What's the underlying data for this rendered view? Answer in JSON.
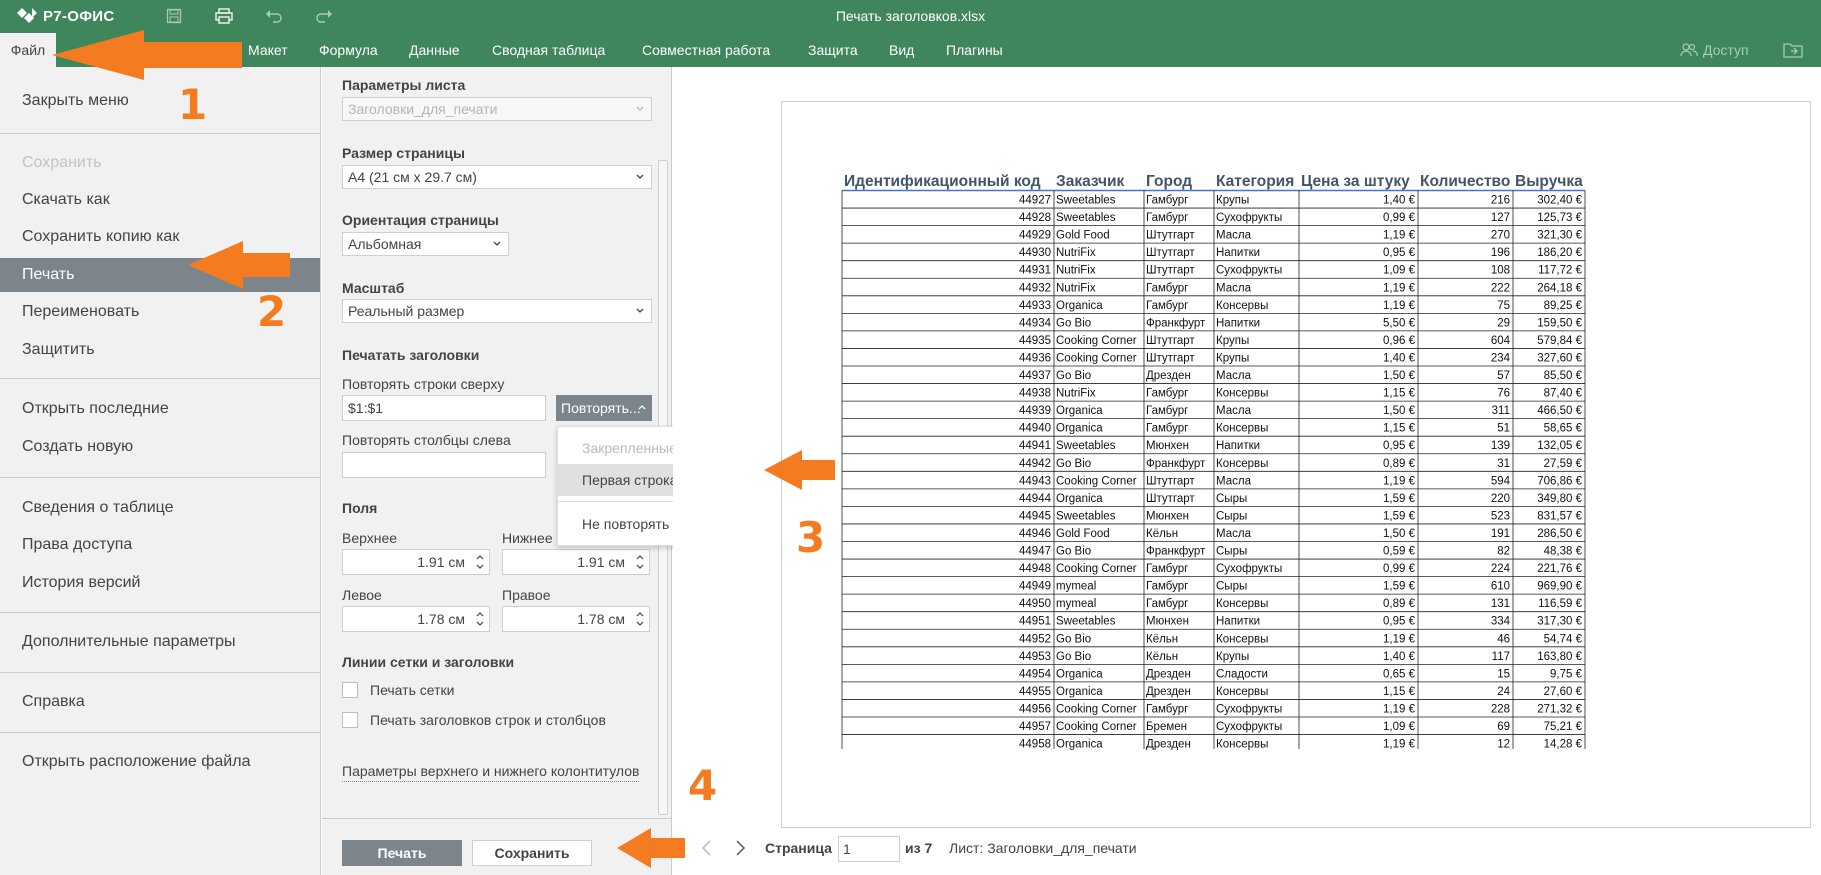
{
  "app": {
    "logo": "Р7-ОФИС",
    "document_title": "Печать заголовков.xlsx"
  },
  "toolbar": {
    "icons": [
      "save-icon",
      "print-icon",
      "undo-icon",
      "redo-icon"
    ]
  },
  "menu": {
    "file": "Файл",
    "tabs": [
      "Макет",
      "Формула",
      "Данные",
      "Сводная таблица",
      "Совместная работа",
      "Защита",
      "Вид",
      "Плагины"
    ],
    "access": "Доступ"
  },
  "file_menu": {
    "close": "Закрыть меню",
    "save": "Сохранить",
    "download_as": "Скачать как",
    "save_copy_as": "Сохранить копию как",
    "print": "Печать",
    "rename": "Переименовать",
    "protect": "Защитить",
    "open_recent": "Открыть последние",
    "create_new": "Создать новую",
    "table_info": "Сведения о таблице",
    "access_rights": "Права доступа",
    "version_history": "История версий",
    "advanced": "Дополнительные параметры",
    "help": "Справка",
    "open_location": "Открыть расположение файла"
  },
  "print_settings": {
    "sheet_params_label": "Параметры листа",
    "sheet_select": "Заголовки_для_печати",
    "page_size_label": "Размер страницы",
    "page_size": "A4 (21 см x 29.7 см)",
    "orientation_label": "Ориентация страницы",
    "orientation": "Альбомная",
    "scale_label": "Масштаб",
    "scale": "Реальный размер",
    "print_titles_label": "Печатать заголовки",
    "repeat_rows_label": "Повторять строки сверху",
    "repeat_rows_value": "$1:$1",
    "repeat_button": "Повторять...",
    "repeat_cols_label": "Повторять столбцы слева",
    "repeat_cols_value": "",
    "margins_label": "Поля",
    "top_label": "Верхнее",
    "top_value": "1.91 см",
    "bottom_label": "Нижнее",
    "bottom_value": "1.91 см",
    "left_label": "Левое",
    "left_value": "1.78 см",
    "right_label": "Правое",
    "right_value": "1.78 см",
    "grid_label": "Линии сетки и заголовки",
    "print_grid": "Печать сетки",
    "print_headings": "Печать заголовков строк и столбцов",
    "header_footer_link": "Параметры верхнего и нижнего колонтитулов",
    "print_button": "Печать",
    "save_button": "Сохранить"
  },
  "dropdown": {
    "frozen_rows": "Закрепленные строки",
    "first_row": "Первая строка",
    "no_repeat": "Не повторять"
  },
  "preview": {
    "page_label": "Страница",
    "page_value": "1",
    "page_of": "из 7",
    "sheet_label": "Лист: Заголовки_для_печати",
    "table": {
      "headers": [
        "Идентификационный код",
        "Заказчик",
        "Город",
        "Категория",
        "Цена за штуку",
        "Количество",
        "Выручка"
      ],
      "rows": [
        [
          "44927",
          "Sweetables",
          "Гамбург",
          "Крупы",
          "1,40 €",
          "216",
          "302,40 €"
        ],
        [
          "44928",
          "Sweetables",
          "Гамбург",
          "Сухофрукты",
          "0,99 €",
          "127",
          "125,73 €"
        ],
        [
          "44929",
          "Gold Food",
          "Штутгарт",
          "Масла",
          "1,19 €",
          "270",
          "321,30 €"
        ],
        [
          "44930",
          "NutriFix",
          "Штутгарт",
          "Напитки",
          "0,95 €",
          "196",
          "186,20 €"
        ],
        [
          "44931",
          "NutriFix",
          "Штутгарт",
          "Сухофрукты",
          "1,09 €",
          "108",
          "117,72 €"
        ],
        [
          "44932",
          "NutriFix",
          "Гамбург",
          "Масла",
          "1,19 €",
          "222",
          "264,18 €"
        ],
        [
          "44933",
          "Organica",
          "Гамбург",
          "Консервы",
          "1,19 €",
          "75",
          "89,25 €"
        ],
        [
          "44934",
          "Go Bio",
          "Франкфурт",
          "Напитки",
          "5,50 €",
          "29",
          "159,50 €"
        ],
        [
          "44935",
          "Cooking Corner",
          "Штутгарт",
          "Крупы",
          "0,96 €",
          "604",
          "579,84 €"
        ],
        [
          "44936",
          "Cooking Corner",
          "Штутгарт",
          "Крупы",
          "1,40 €",
          "234",
          "327,60 €"
        ],
        [
          "44937",
          "Go Bio",
          "Дрезден",
          "Масла",
          "1,50 €",
          "57",
          "85,50 €"
        ],
        [
          "44938",
          "NutriFix",
          "Гамбург",
          "Консервы",
          "1,15 €",
          "76",
          "87,40 €"
        ],
        [
          "44939",
          "Organica",
          "Гамбург",
          "Масла",
          "1,50 €",
          "311",
          "466,50 €"
        ],
        [
          "44940",
          "Organica",
          "Гамбург",
          "Консервы",
          "1,15 €",
          "51",
          "58,65 €"
        ],
        [
          "44941",
          "Sweetables",
          "Мюнхен",
          "Напитки",
          "0,95 €",
          "139",
          "132,05 €"
        ],
        [
          "44942",
          "Go Bio",
          "Франкфурт",
          "Консервы",
          "0,89 €",
          "31",
          "27,59 €"
        ],
        [
          "44943",
          "Cooking Corner",
          "Штутгарт",
          "Масла",
          "1,19 €",
          "594",
          "706,86 €"
        ],
        [
          "44944",
          "Organica",
          "Штутгарт",
          "Сыры",
          "1,59 €",
          "220",
          "349,80 €"
        ],
        [
          "44945",
          "Sweetables",
          "Мюнхен",
          "Сыры",
          "1,59 €",
          "523",
          "831,57 €"
        ],
        [
          "44946",
          "Gold Food",
          "Кёльн",
          "Масла",
          "1,50 €",
          "191",
          "286,50 €"
        ],
        [
          "44947",
          "Go Bio",
          "Франкфурт",
          "Сыры",
          "0,59 €",
          "82",
          "48,38 €"
        ],
        [
          "44948",
          "Cooking Corner",
          "Гамбург",
          "Сухофрукты",
          "0,99 €",
          "224",
          "221,76 €"
        ],
        [
          "44949",
          "mymeal",
          "Гамбург",
          "Сыры",
          "1,59 €",
          "610",
          "969,90 €"
        ],
        [
          "44950",
          "mymeal",
          "Гамбург",
          "Консервы",
          "0,89 €",
          "131",
          "116,59 €"
        ],
        [
          "44951",
          "Sweetables",
          "Мюнхен",
          "Напитки",
          "0,95 €",
          "334",
          "317,30 €"
        ],
        [
          "44952",
          "Go Bio",
          "Кёльн",
          "Консервы",
          "1,19 €",
          "46",
          "54,74 €"
        ],
        [
          "44953",
          "Go Bio",
          "Кёльн",
          "Крупы",
          "1,40 €",
          "117",
          "163,80 €"
        ],
        [
          "44954",
          "Organica",
          "Дрезден",
          "Сладости",
          "0,65 €",
          "15",
          "9,75 €"
        ],
        [
          "44955",
          "Organica",
          "Дрезден",
          "Консервы",
          "1,15 €",
          "24",
          "27,60 €"
        ],
        [
          "44956",
          "Cooking Corner",
          "Гамбург",
          "Сухофрукты",
          "1,19 €",
          "228",
          "271,32 €"
        ],
        [
          "44957",
          "Cooking Corner",
          "Бремен",
          "Сухофрукты",
          "1,09 €",
          "69",
          "75,21 €"
        ],
        [
          "44958",
          "Organica",
          "Дрезден",
          "Консервы",
          "1,19 €",
          "12",
          "14,28 €"
        ]
      ]
    }
  },
  "annotations": {
    "step1": "1",
    "step2": "2",
    "step3": "3",
    "step4": "4"
  },
  "colors": {
    "brand_green": "#40865c",
    "accent_orange": "#f47b20",
    "selected_gray": "#7d858c",
    "table_header_blue": "#44546a"
  }
}
